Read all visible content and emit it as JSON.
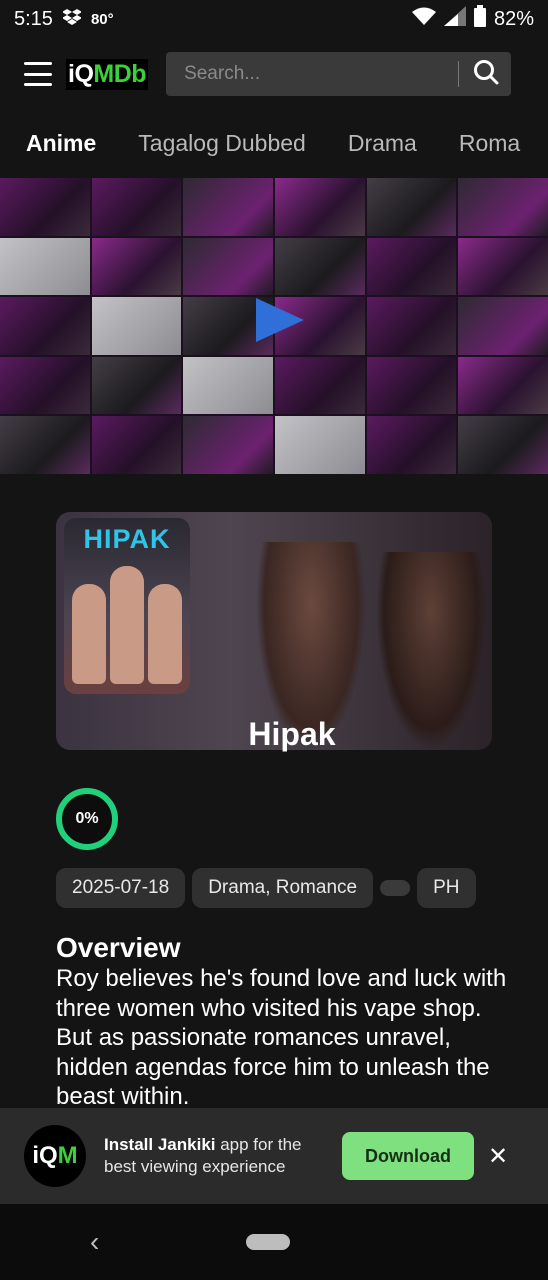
{
  "status": {
    "time": "5:15",
    "temperature": "80°",
    "battery": "82%",
    "icons": [
      "dropbox-icon",
      "wifi-icon",
      "signal-icon",
      "battery-icon"
    ]
  },
  "header": {
    "logo_iq": "iQ",
    "logo_mdb": "MDb",
    "search_placeholder": "Search..."
  },
  "tabs": [
    "Anime",
    "Tagalog Dubbed",
    "Drama",
    "Roma"
  ],
  "poster": {
    "thumb_title": "HIPAK",
    "title": "Hipak"
  },
  "score": "0%",
  "chips": {
    "date": "2025-07-18",
    "genres": "Drama, Romance",
    "country": "PH"
  },
  "overview": {
    "heading": "Overview",
    "text": "Roy believes he's found love and luck with three women who visited his vape shop. But as passionate romances unravel, hidden agendas force him to unleash the beast within."
  },
  "banner": {
    "app_icon_i": "iQ",
    "app_icon_m": "M",
    "install_bold": "Install Jankiki",
    "install_rest": " app for the best viewing experience",
    "download_label": "Download",
    "close_label": "✕"
  },
  "colors": {
    "accent_green": "#3ad13a",
    "score_ring": "#21d07a",
    "download_bg": "#7ee07e",
    "play_blue": "#2f6fd8"
  }
}
